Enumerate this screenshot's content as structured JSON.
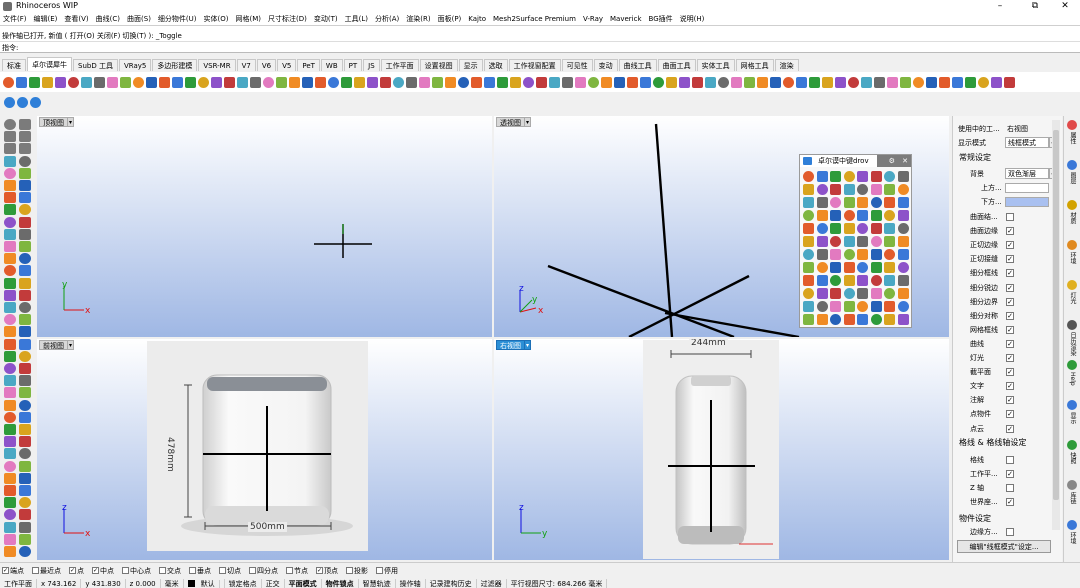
{
  "window": {
    "title": "Rhinoceros WIP",
    "controls": [
      "–",
      "⧉",
      "✕"
    ]
  },
  "menu": [
    "文件(F)",
    "编辑(E)",
    "查看(V)",
    "曲线(C)",
    "曲面(S)",
    "细分物件(U)",
    "实体(O)",
    "网格(M)",
    "尺寸标注(D)",
    "变动(T)",
    "工具(L)",
    "分析(A)",
    "渲染(R)",
    "面板(P)",
    "Kajto",
    "Mesh2Surface Premium",
    "V-Ray",
    "Maverick",
    "BG插件",
    "说明(H)"
  ],
  "command_history": "操作轴已打开, 新值 ( 打开(O) 关闭(F) 切换(T) ): _Toggle",
  "command_prompt": "指令:",
  "tabs": [
    "标准",
    "卓尔谟犀牛",
    "SubD 工具",
    "VRay5",
    "多边形建模",
    "VSR-MR",
    "V7",
    "V6",
    "V5",
    "PeT",
    "WB",
    "PT",
    "JS",
    "工作平面",
    "设置视图",
    "显示",
    "选取",
    "工作视窗配置",
    "可见性",
    "变动",
    "曲线工具",
    "曲面工具",
    "实体工具",
    "网格工具",
    "渲染"
  ],
  "active_tab": "卓尔谟犀牛",
  "viewports": {
    "top": {
      "label": "顶视图"
    },
    "perspective": {
      "label": "透视图"
    },
    "front": {
      "label": "前视图",
      "dim_height": "478mm",
      "dim_width": "500mm"
    },
    "right": {
      "label": "右视图",
      "dim_width": "244mm"
    }
  },
  "floating_toolbar": {
    "title": "卓尔谟中键drov",
    "settings_icon": "⚙",
    "close_icon": "✕"
  },
  "panel": {
    "viewport_row": {
      "label": "使用中的工...",
      "value": "右视图"
    },
    "display_mode": {
      "label": "显示模式",
      "value": "线框模式"
    },
    "general_section": "常规设定",
    "background": {
      "label": "背景",
      "value": "双色渐层"
    },
    "top_color_label": "上方...",
    "bottom_color_label": "下方...",
    "display_items": [
      {
        "label": "曲面结...",
        "checked": false
      },
      {
        "label": "曲面边缘",
        "checked": true
      },
      {
        "label": "正切边缘",
        "checked": true
      },
      {
        "label": "正切接缝",
        "checked": true
      },
      {
        "label": "细分框线",
        "checked": true
      },
      {
        "label": "细分锐边",
        "checked": true
      },
      {
        "label": "细分边界",
        "checked": true
      },
      {
        "label": "细分对称",
        "checked": true
      },
      {
        "label": "网格框线",
        "checked": true
      },
      {
        "label": "曲线",
        "checked": true
      },
      {
        "label": "灯光",
        "checked": true
      },
      {
        "label": "截平面",
        "checked": true
      },
      {
        "label": "文字",
        "checked": true
      },
      {
        "label": "注解",
        "checked": true
      },
      {
        "label": "点物件",
        "checked": true
      },
      {
        "label": "点云",
        "checked": true
      }
    ],
    "grid_section": "格线 & 格线轴设定",
    "grid_items": [
      {
        "label": "格线",
        "checked": false
      },
      {
        "label": "工作平...",
        "checked": true
      },
      {
        "label": "Z 轴",
        "checked": false
      },
      {
        "label": "世界座...",
        "checked": true
      }
    ],
    "object_section": "物件设定",
    "object_items": [
      {
        "label": "边缘方...",
        "checked": false
      }
    ],
    "edit_button": "编辑\"线框模式\"设定..."
  },
  "side_tabs": [
    "属性",
    "图层",
    "材质",
    "环境",
    "灯光",
    "日历渲染",
    "Help",
    "显示",
    "快照",
    "库链",
    "环境"
  ],
  "osnaps": [
    {
      "label": "端点",
      "checked": true
    },
    {
      "label": "最近点",
      "checked": false
    },
    {
      "label": "点",
      "checked": true
    },
    {
      "label": "中点",
      "checked": true
    },
    {
      "label": "中心点",
      "checked": false
    },
    {
      "label": "交点",
      "checked": false
    },
    {
      "label": "垂点",
      "checked": false
    },
    {
      "label": "切点",
      "checked": false
    },
    {
      "label": "四分点",
      "checked": false
    },
    {
      "label": "节点",
      "checked": false
    },
    {
      "label": "顶点",
      "checked": true
    },
    {
      "label": "投影",
      "checked": false
    },
    {
      "label": "停用",
      "checked": false
    }
  ],
  "status": {
    "cplane": "工作平面",
    "x": "x 743.162",
    "y": "y 431.830",
    "z": "z 0.000",
    "unit": "毫米",
    "layer": "默认",
    "items": [
      "锁定格点",
      "正交",
      "平面模式",
      "物件锁点",
      "智慧轨迹",
      "操作轴",
      "记录建构历史",
      "过滤器",
      "平行视图尺寸: 684.266 毫米"
    ]
  },
  "colors": {
    "viewport_top": "#ffffff",
    "viewport_bottom": "#9fb7e4",
    "active_label": "#2b8fd6",
    "x_axis": "#e01010",
    "y_axis": "#10a010",
    "z_axis": "#1010e0"
  }
}
